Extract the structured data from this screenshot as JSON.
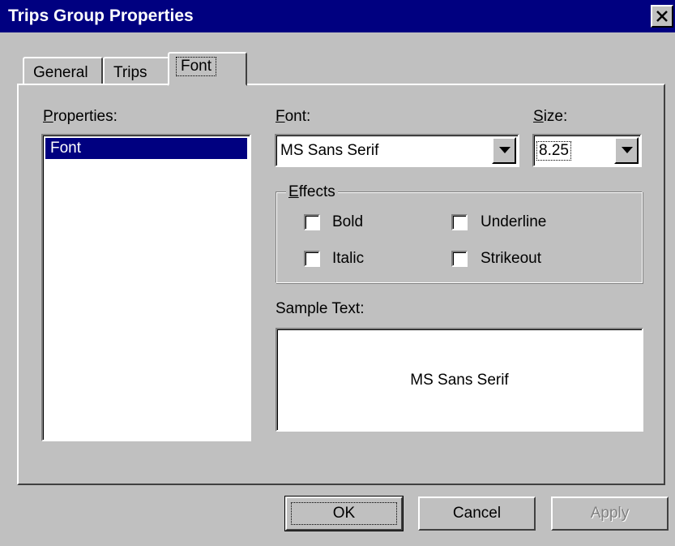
{
  "window": {
    "title": "Trips Group Properties",
    "close_icon": "close-x-icon"
  },
  "tabs": [
    {
      "label": "General",
      "active": false
    },
    {
      "label": "Trips",
      "active": false
    },
    {
      "label": "Font",
      "active": true
    }
  ],
  "properties": {
    "label_prefix": "P",
    "label_rest": "roperties:",
    "items": [
      {
        "label": "Font",
        "selected": true
      }
    ]
  },
  "font": {
    "label_prefix": "F",
    "label_rest": "ont:",
    "value": "MS Sans Serif"
  },
  "size": {
    "label_prefix": "S",
    "label_rest": "ize:",
    "value": "8.25"
  },
  "effects": {
    "legend_prefix": "E",
    "legend_rest": "ffects",
    "options": [
      {
        "label": "Bold",
        "checked": false
      },
      {
        "label": "Underline",
        "checked": false
      },
      {
        "label": "Italic",
        "checked": false
      },
      {
        "label": "Strikeout",
        "checked": false
      }
    ]
  },
  "sample": {
    "label": "Sample Text:",
    "text": "MS Sans Serif"
  },
  "buttons": {
    "ok": "OK",
    "cancel": "Cancel",
    "apply": "Apply"
  },
  "colors": {
    "face": "#c0c0c0",
    "titlebar": "#000080",
    "selection": "#000080"
  }
}
